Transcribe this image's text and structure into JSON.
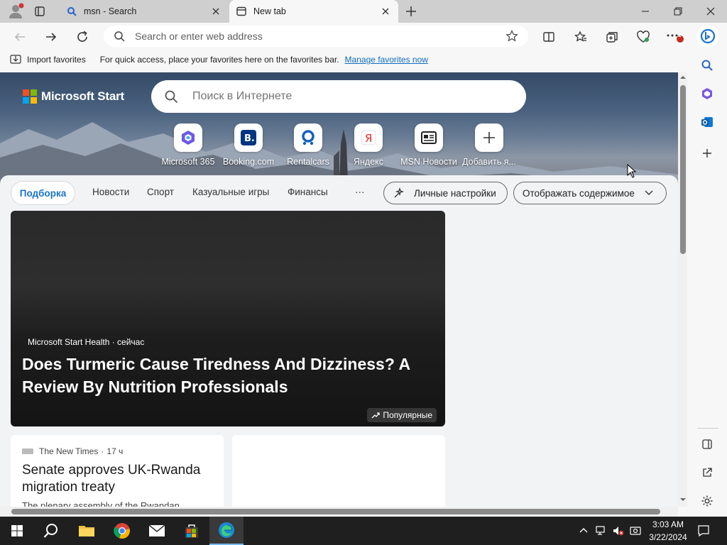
{
  "browser": {
    "tabs": [
      {
        "title": "msn - Search",
        "active": false
      },
      {
        "title": "New tab",
        "active": true
      }
    ],
    "address_placeholder": "Search or enter web address",
    "notification_badge": "1"
  },
  "favorites_bar": {
    "import_label": "Import favorites",
    "hint_text": "For quick access, place your favorites here on the favorites bar.",
    "manage_link": "Manage favorites now"
  },
  "newtab": {
    "brand": "Microsoft Start",
    "search_placeholder": "Поиск в Интернете",
    "quick_links": [
      {
        "label": "Microsoft 365"
      },
      {
        "label": "Booking.com"
      },
      {
        "label": "Rentalcars"
      },
      {
        "label": "Яндекс"
      },
      {
        "label": "MSN Новости"
      },
      {
        "label": "Добавить я..."
      }
    ],
    "nav": {
      "active": "Подборка",
      "items": [
        "Новости",
        "Спорт",
        "Казуальные игры",
        "Финансы"
      ],
      "more": "···",
      "personalize": "Личные настройки",
      "show_content": "Отображать содержимое"
    },
    "hero_card": {
      "source": "Microsoft Start Health · сейчас",
      "title": "Does Turmeric Cause Tiredness And Dizziness? A Review By Nutrition Professionals",
      "badge": "Популярные"
    },
    "small_card": {
      "source": "The New Times",
      "time": "17 ч",
      "title": "Senate approves UK-Rwanda migration treaty",
      "snippet": "The plenary assembly of the Rwandan"
    }
  },
  "taskbar": {
    "time": "3:03 AM",
    "date": "3/22/2024"
  },
  "colors": {
    "accent": "#0f6cbd",
    "taskbar": "#1f1f1f",
    "tab_strip": "#cfcfcf"
  }
}
